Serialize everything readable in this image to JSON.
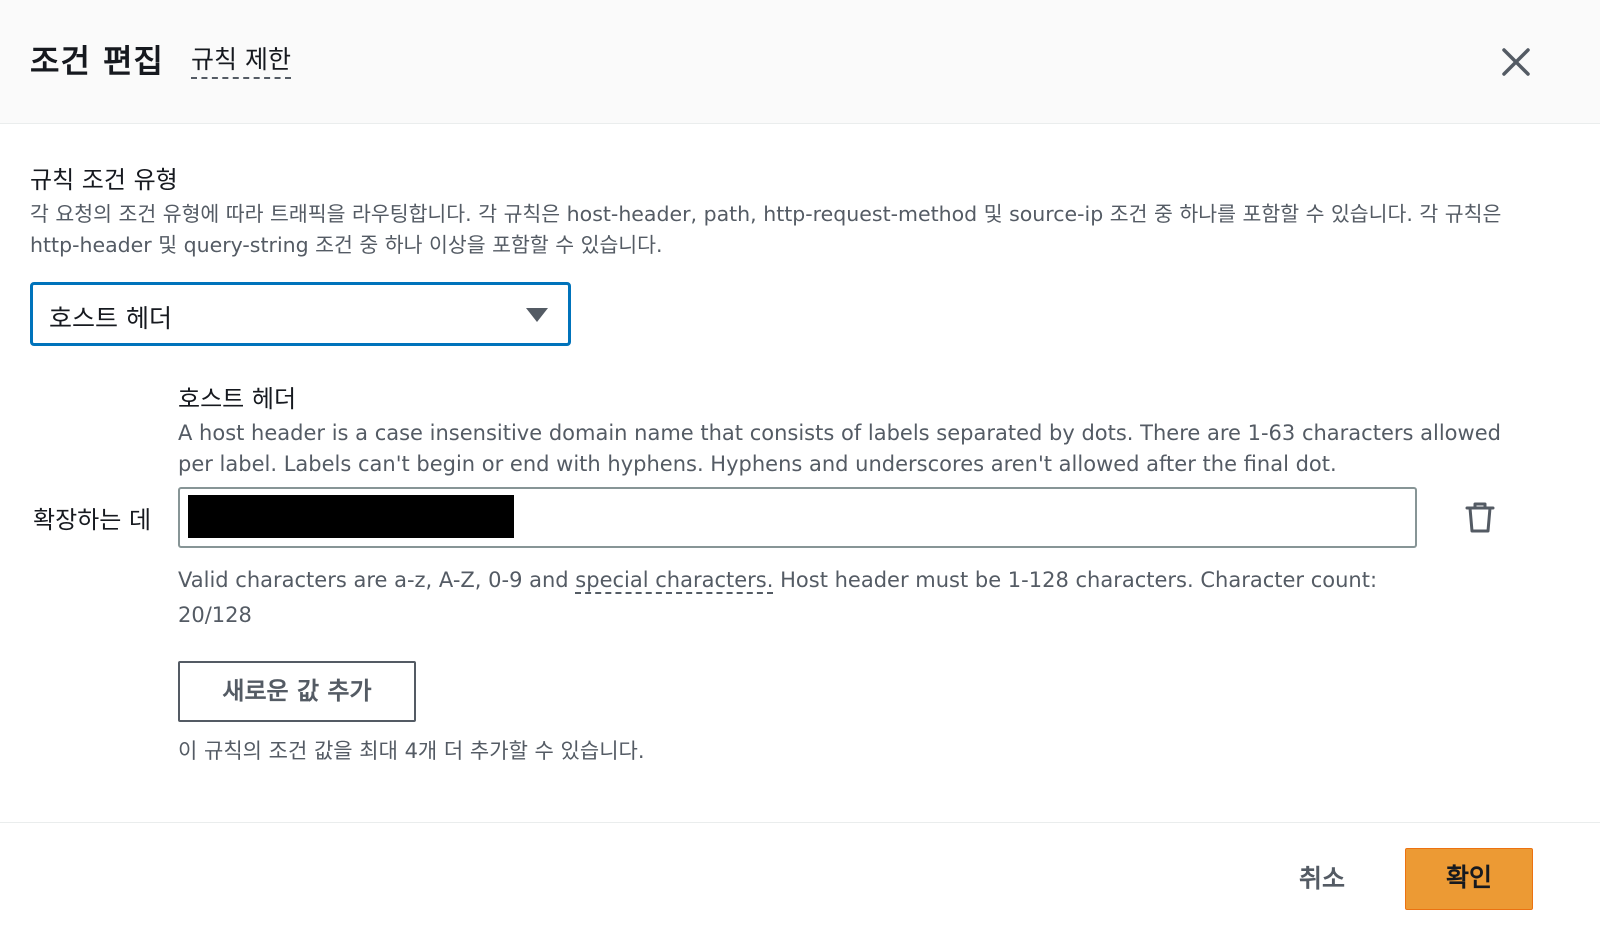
{
  "header": {
    "title": "조건 편집",
    "subtitle_link": "규칙 제한",
    "close_icon": "close-icon"
  },
  "condition_type": {
    "label": "규칙 조건 유형",
    "description": "각 요청의 조건 유형에 따라 트래픽을 라우팅합니다. 각 규칙은 host-header, path, http-request-method 및 source-ip 조건 중 하나를 포함할 수 있습니다. 각 규칙은 http-header 및 query-string 조건 중 하나 이상을 포함할 수 있습니다.",
    "selected": "호스트 헤더"
  },
  "host_header": {
    "label": "호스트 헤더",
    "description": "A host header is a case insensitive domain name that consists of labels separated by dots. There are 1-63 characters allowed per label. Labels can't begin or end with hyphens. Hyphens and underscores aren't allowed after the final dot.",
    "row_label": "확장하는 데",
    "value_redacted": true,
    "constraint_prefix": "Valid characters are a-z, A-Z, 0-9 and ",
    "constraint_link": "special characters.",
    "constraint_suffix": " Host header must be 1-128 characters. Character count: 20/128",
    "character_count": "20/128",
    "delete_icon": "trash-icon"
  },
  "add_value": {
    "label": "새로운 값 추가",
    "hint": "이 규칙의 조건 값을 최대 4개 더 추가할 수 있습니다."
  },
  "footer": {
    "cancel_label": "취소",
    "confirm_label": "확인"
  },
  "colors": {
    "accent_orange": "#ec9a34",
    "focus_blue": "#0073bb",
    "text_muted": "#545b64"
  }
}
